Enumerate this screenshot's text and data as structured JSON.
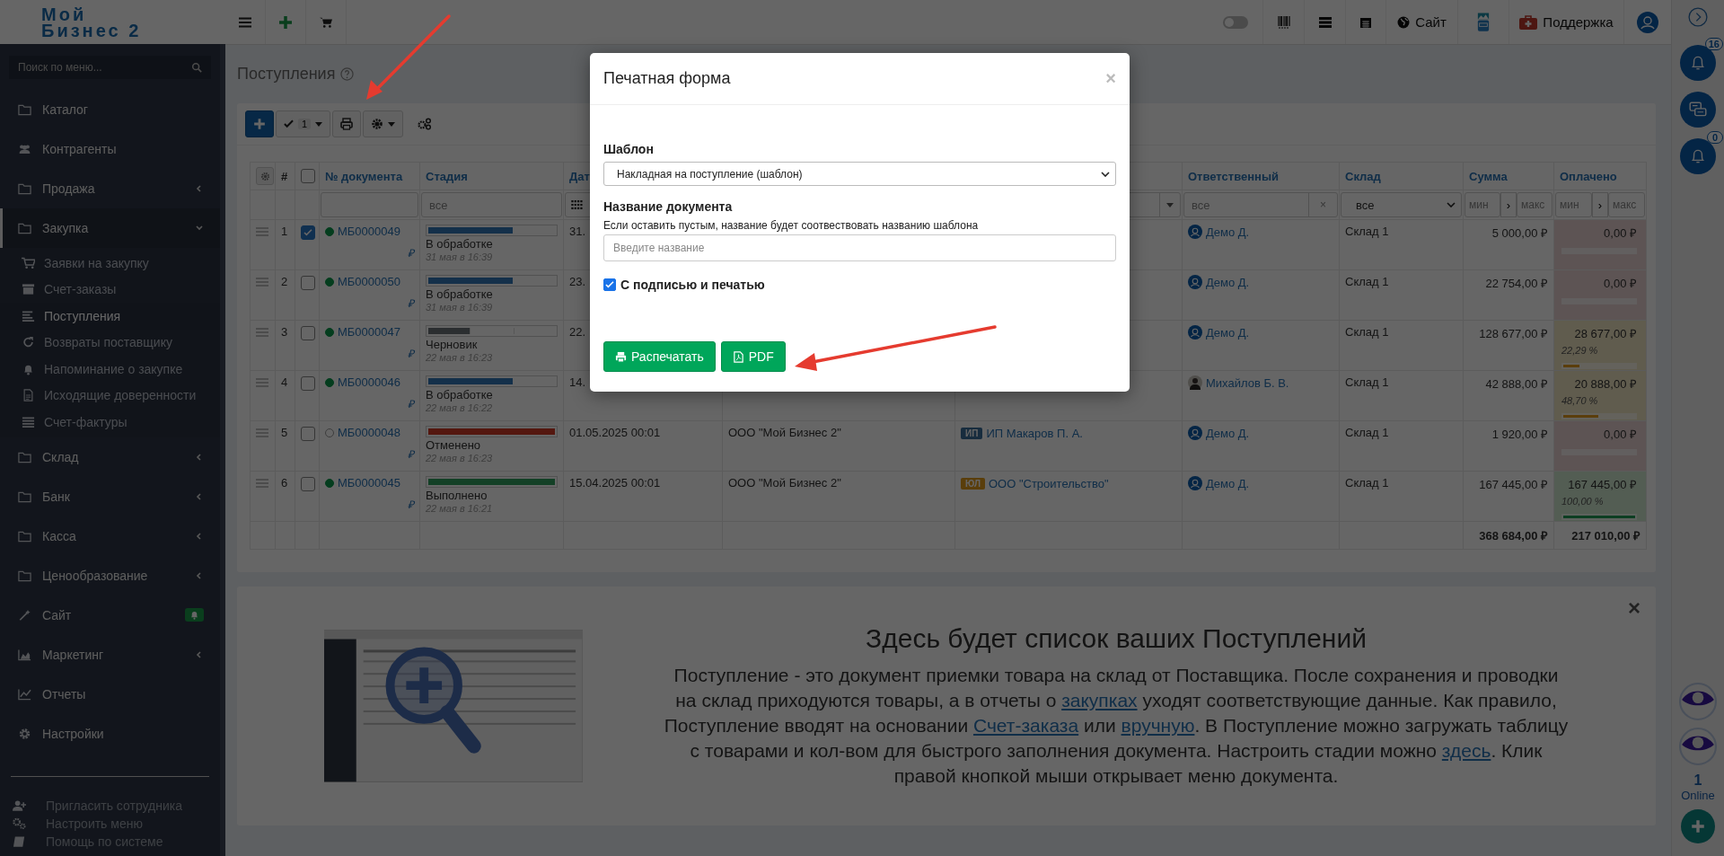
{
  "logo": {
    "line1": "Мой",
    "line2": "Бизнес 2"
  },
  "topbar": {
    "dark_mode_toggle": {
      "on": false
    },
    "site_link": "Сайт",
    "support_link": "Поддержка"
  },
  "sidebar": {
    "search": {
      "placeholder": "Поиск по меню..."
    },
    "items": [
      {
        "label": "Каталог",
        "kind": "link"
      },
      {
        "label": "Контрагенты",
        "kind": "link"
      },
      {
        "label": "Продажа",
        "kind": "group",
        "expanded": false,
        "selected": false
      },
      {
        "label": "Закупка",
        "kind": "group",
        "expanded": true,
        "selected": true,
        "children": [
          {
            "label": "Заявки на закупку",
            "selected": false
          },
          {
            "label": "Счет-заказы",
            "selected": false
          },
          {
            "label": "Поступления",
            "selected": true
          },
          {
            "label": "Возвраты поставщику",
            "selected": false
          },
          {
            "label": "Напоминание о закупке",
            "selected": false
          },
          {
            "label": "Исходящие доверенности",
            "selected": false
          },
          {
            "label": "Счет-фактуры",
            "selected": false
          }
        ]
      },
      {
        "label": "Склад",
        "kind": "group",
        "expanded": false,
        "selected": false
      },
      {
        "label": "Банк",
        "kind": "group",
        "expanded": false,
        "selected": false
      },
      {
        "label": "Касса",
        "kind": "group",
        "expanded": false,
        "selected": false
      },
      {
        "label": "Ценообразование",
        "kind": "group",
        "expanded": false,
        "selected": false
      },
      {
        "label": "Сайт",
        "kind": "alert-link"
      },
      {
        "label": "Маркетинг",
        "kind": "group",
        "expanded": false,
        "selected": false
      },
      {
        "label": "Отчеты",
        "kind": "link"
      },
      {
        "label": "Настройки",
        "kind": "link"
      }
    ],
    "footer": [
      "Пригласить сотрудника",
      "Настроить меню",
      "Помощь по системе"
    ]
  },
  "page": {
    "title": "Поступления",
    "toolbar": {
      "selected_count": "1"
    }
  },
  "table": {
    "columns": {
      "number": "#",
      "document": "№ документа",
      "stage": "Стадия",
      "date": "Дат",
      "responsible": "Ответственный",
      "warehouse": "Склад",
      "sum": "Сумма",
      "paid": "Оплачено"
    },
    "all_checked": false,
    "filters": {
      "stage": {
        "placeholder": "все"
      },
      "responsible": {
        "placeholder": "все",
        "clear": "×"
      },
      "warehouse": {
        "value": "все"
      },
      "sum": {
        "min_placeholder": "мин",
        "apply": "›",
        "max_placeholder": "макс"
      },
      "paid": {
        "min_placeholder": "мин",
        "apply": "›",
        "max_placeholder": "макс"
      }
    },
    "rows": [
      {
        "number": "1",
        "checked": true,
        "document": "МБ0000049",
        "active": true,
        "currency": "₽",
        "stage": {
          "label": "В обработке",
          "time": "31 мая в 16:39",
          "level": 0.667,
          "color": "#14304a"
        },
        "date": "31.",
        "responsible": {
          "name": "Демо Д.",
          "kind": "icon"
        },
        "warehouse": "Склад 1",
        "sum": "5 000,00 ₽",
        "paid": {
          "amount": "0,00 ₽",
          "color": "#5d5454"
        }
      },
      {
        "number": "2",
        "checked": false,
        "document": "МБ0000050",
        "active": true,
        "currency": "₽",
        "stage": {
          "label": "В обработке",
          "time": "31 мая в 16:39",
          "level": 0.667,
          "color": "#14304a"
        },
        "date": "23.",
        "responsible": {
          "name": "Демо Д.",
          "kind": "icon"
        },
        "warehouse": "Склад 1",
        "sum": "22 754,00 ₽",
        "paid": {
          "amount": "0,00 ₽",
          "color": "#5d5454"
        }
      },
      {
        "number": "3",
        "checked": false,
        "document": "МБ0000047",
        "active": true,
        "currency": "₽",
        "stage": {
          "label": "Черновик",
          "time": "22 мая в 16:23",
          "level": 0.333,
          "color": "#2b2e30"
        },
        "date": "22.",
        "responsible": {
          "name": "Демо Д.",
          "kind": "icon"
        },
        "warehouse": "Склад 1",
        "sum": "128 677,00 ₽",
        "paid": {
          "amount": "28 677,00 ₽",
          "percent": "22,29 %",
          "color": "#605c4e",
          "bar": {
            "color": "#5b3e0b",
            "level": 0.2229
          }
        }
      },
      {
        "number": "4",
        "checked": false,
        "document": "МБ0000046",
        "active": true,
        "currency": "₽",
        "stage": {
          "label": "В обработке",
          "time": "22 мая в 16:22",
          "level": 0.667,
          "color": "#14304a"
        },
        "date": "14.",
        "responsible": {
          "name": "Михайлов Б. В.",
          "kind": "photo"
        },
        "warehouse": "Склад 1",
        "sum": "42 888,00 ₽",
        "paid": {
          "amount": "20 888,00 ₽",
          "percent": "48,70 %",
          "color": "#605c4e",
          "bar": {
            "color": "#5b3e0b",
            "level": 0.487
          }
        }
      },
      {
        "number": "5",
        "checked": false,
        "document": "МБ0000048",
        "active": false,
        "currency": "₽",
        "stage": {
          "label": "Отменено",
          "time": "22 мая в 16:23",
          "level": 1,
          "color": "#54170f"
        },
        "date": "01.05.2025 00:01",
        "organization": "ООО \"Мой Бизнес 2\"",
        "contractor": {
          "badge": "ИП",
          "color": "#172c3e",
          "name": "ИП Макаров П. А."
        },
        "responsible": {
          "name": "Демо Д.",
          "kind": "icon"
        },
        "warehouse": "Склад 1",
        "sum": "1 920,00 ₽",
        "paid": {
          "amount": "0,00 ₽",
          "color": "#5d5454"
        }
      },
      {
        "number": "6",
        "checked": false,
        "document": "МБ0000045",
        "active": true,
        "currency": "₽",
        "stage": {
          "label": "Выполнено",
          "time": "22 мая в 16:21",
          "level": 1,
          "color": "#134026"
        },
        "date": "15.04.2025 00:01",
        "organization": "ООО \"Мой Бизнес 2\"",
        "contractor": {
          "badge": "ЮЛ",
          "color": "#5a3e0b",
          "name": "ООО \"Строительство\""
        },
        "responsible": {
          "name": "Демо Д.",
          "kind": "icon"
        },
        "warehouse": "Склад 1",
        "sum": "167 445,00 ₽",
        "paid": {
          "amount": "167 445,00 ₽",
          "percent": "100,00 %",
          "color": "#535d53",
          "bar": {
            "color": "#0c3e22",
            "level": 1
          }
        }
      }
    ],
    "totals": {
      "sum": "368 684,00 ₽",
      "paid": "217 010,00 ₽"
    }
  },
  "promo": {
    "close": "×",
    "title": "Здесь будет список ваших Поступлений",
    "text": [
      "Поступление - это документ приемки товара на склад от Поставщика. После сохранения и проводки на склад приходуются товары, а в отчеты о ",
      {
        "link": "закупках"
      },
      " уходят соответствующие данные. Как правило, Поступление вводят на основании ",
      {
        "link": "Счет-заказа"
      },
      " или ",
      {
        "link": "вручную"
      },
      ". В Поступление можно загружать таблицу с товарами и кол-вом для быстрого заполнения документа. Настроить стадии можно ",
      {
        "link": "здесь"
      },
      ". Клик правой кнопкой мыши открывает меню документа."
    ]
  },
  "right_panel": {
    "notifications": "16",
    "reminders": "0",
    "online_count": "1",
    "online_label": "Online"
  },
  "modal": {
    "title": "Печатная форма",
    "close": "×",
    "template_label": "Шаблон",
    "template_value": "Накладная на поступление (шаблон)",
    "name_label": "Название документа",
    "name_hint": "Если оставить пустым, название будет соотвествовать названию шаблона",
    "name_placeholder": "Введите название",
    "signature": {
      "label": "С подписью и печатью",
      "checked": true
    },
    "buttons": [
      {
        "label": "Распечатать",
        "kind": "print"
      },
      {
        "label": "PDF",
        "kind": "pdf"
      }
    ]
  }
}
